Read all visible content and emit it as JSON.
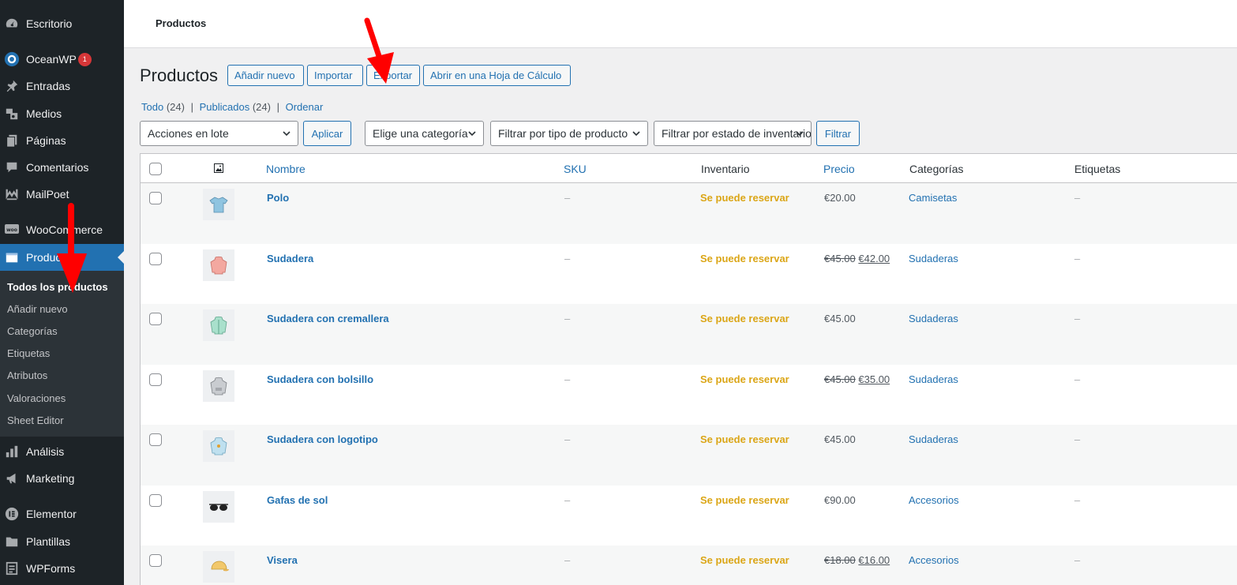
{
  "sidebar": {
    "items": [
      {
        "label": "Escritorio",
        "icon": "dashboard-icon"
      },
      {
        "label": "OceanWP",
        "icon": "oceanwp-icon",
        "badge": "1"
      },
      {
        "label": "Entradas",
        "icon": "pin-icon"
      },
      {
        "label": "Medios",
        "icon": "media-icon"
      },
      {
        "label": "Páginas",
        "icon": "pages-icon"
      },
      {
        "label": "Comentarios",
        "icon": "comments-icon"
      },
      {
        "label": "MailPoet",
        "icon": "mailpoet-icon"
      },
      {
        "label": "WooCommerce",
        "icon": "woocommerce-icon"
      },
      {
        "label": "Productos",
        "icon": "products-icon"
      },
      {
        "label": "Análisis",
        "icon": "analytics-icon"
      },
      {
        "label": "Marketing",
        "icon": "megaphone-icon"
      },
      {
        "label": "Elementor",
        "icon": "elementor-icon"
      },
      {
        "label": "Plantillas",
        "icon": "folder-icon"
      },
      {
        "label": "WPForms",
        "icon": "forms-icon"
      }
    ],
    "submenu": [
      "Todos los productos",
      "Añadir nuevo",
      "Categorías",
      "Etiquetas",
      "Atributos",
      "Valoraciones",
      "Sheet Editor"
    ]
  },
  "topbar": {
    "title": "Productos"
  },
  "header": {
    "title": "Productos",
    "buttons": {
      "add_new": "Añadir nuevo",
      "import": "Importar",
      "export": "Exportar",
      "spreadsheet": "Abrir en una Hoja de Cálculo"
    }
  },
  "views": {
    "all": "Todo",
    "all_count": "(24)",
    "published": "Publicados",
    "published_count": "(24)",
    "sort": "Ordenar"
  },
  "filters": {
    "bulk_actions": "Acciones en lote",
    "apply": "Aplicar",
    "category": "Elige una categoría",
    "product_type": "Filtrar por tipo de producto",
    "stock_status": "Filtrar por estado de inventario",
    "filter": "Filtrar"
  },
  "table": {
    "columns": {
      "name": "Nombre",
      "sku": "SKU",
      "stock": "Inventario",
      "price": "Precio",
      "categories": "Categorías",
      "tags": "Etiquetas"
    },
    "rows": [
      {
        "name": "Polo",
        "sku": "–",
        "stock": "Se puede reservar",
        "price_old": "",
        "price": "€20.00",
        "category": "Camisetas",
        "tags": "–",
        "thumb": "polo"
      },
      {
        "name": "Sudadera",
        "sku": "–",
        "stock": "Se puede reservar",
        "price_old": "€45.00",
        "price": "€42.00",
        "category": "Sudaderas",
        "tags": "–",
        "thumb": "hoodie-pink"
      },
      {
        "name": "Sudadera con cremallera",
        "sku": "–",
        "stock": "Se puede reservar",
        "price_old": "",
        "price": "€45.00",
        "category": "Sudaderas",
        "tags": "–",
        "thumb": "hoodie-green"
      },
      {
        "name": "Sudadera con bolsillo",
        "sku": "–",
        "stock": "Se puede reservar",
        "price_old": "€45.00",
        "price": "€35.00",
        "category": "Sudaderas",
        "tags": "–",
        "thumb": "hoodie-grey"
      },
      {
        "name": "Sudadera con logotipo",
        "sku": "–",
        "stock": "Se puede reservar",
        "price_old": "",
        "price": "€45.00",
        "category": "Sudaderas",
        "tags": "–",
        "thumb": "hoodie-blue"
      },
      {
        "name": "Gafas de sol",
        "sku": "–",
        "stock": "Se puede reservar",
        "price_old": "",
        "price": "€90.00",
        "category": "Accesorios",
        "tags": "–",
        "thumb": "sunglasses"
      },
      {
        "name": "Visera",
        "sku": "–",
        "stock": "Se puede reservar",
        "price_old": "€18.00",
        "price": "€16.00",
        "category": "Accesorios",
        "tags": "–",
        "thumb": "cap"
      }
    ]
  },
  "colors": {
    "accent": "#2271b1",
    "sidebar": "#1d2327",
    "stock": "#dba617",
    "arrow": "#ff0000"
  }
}
